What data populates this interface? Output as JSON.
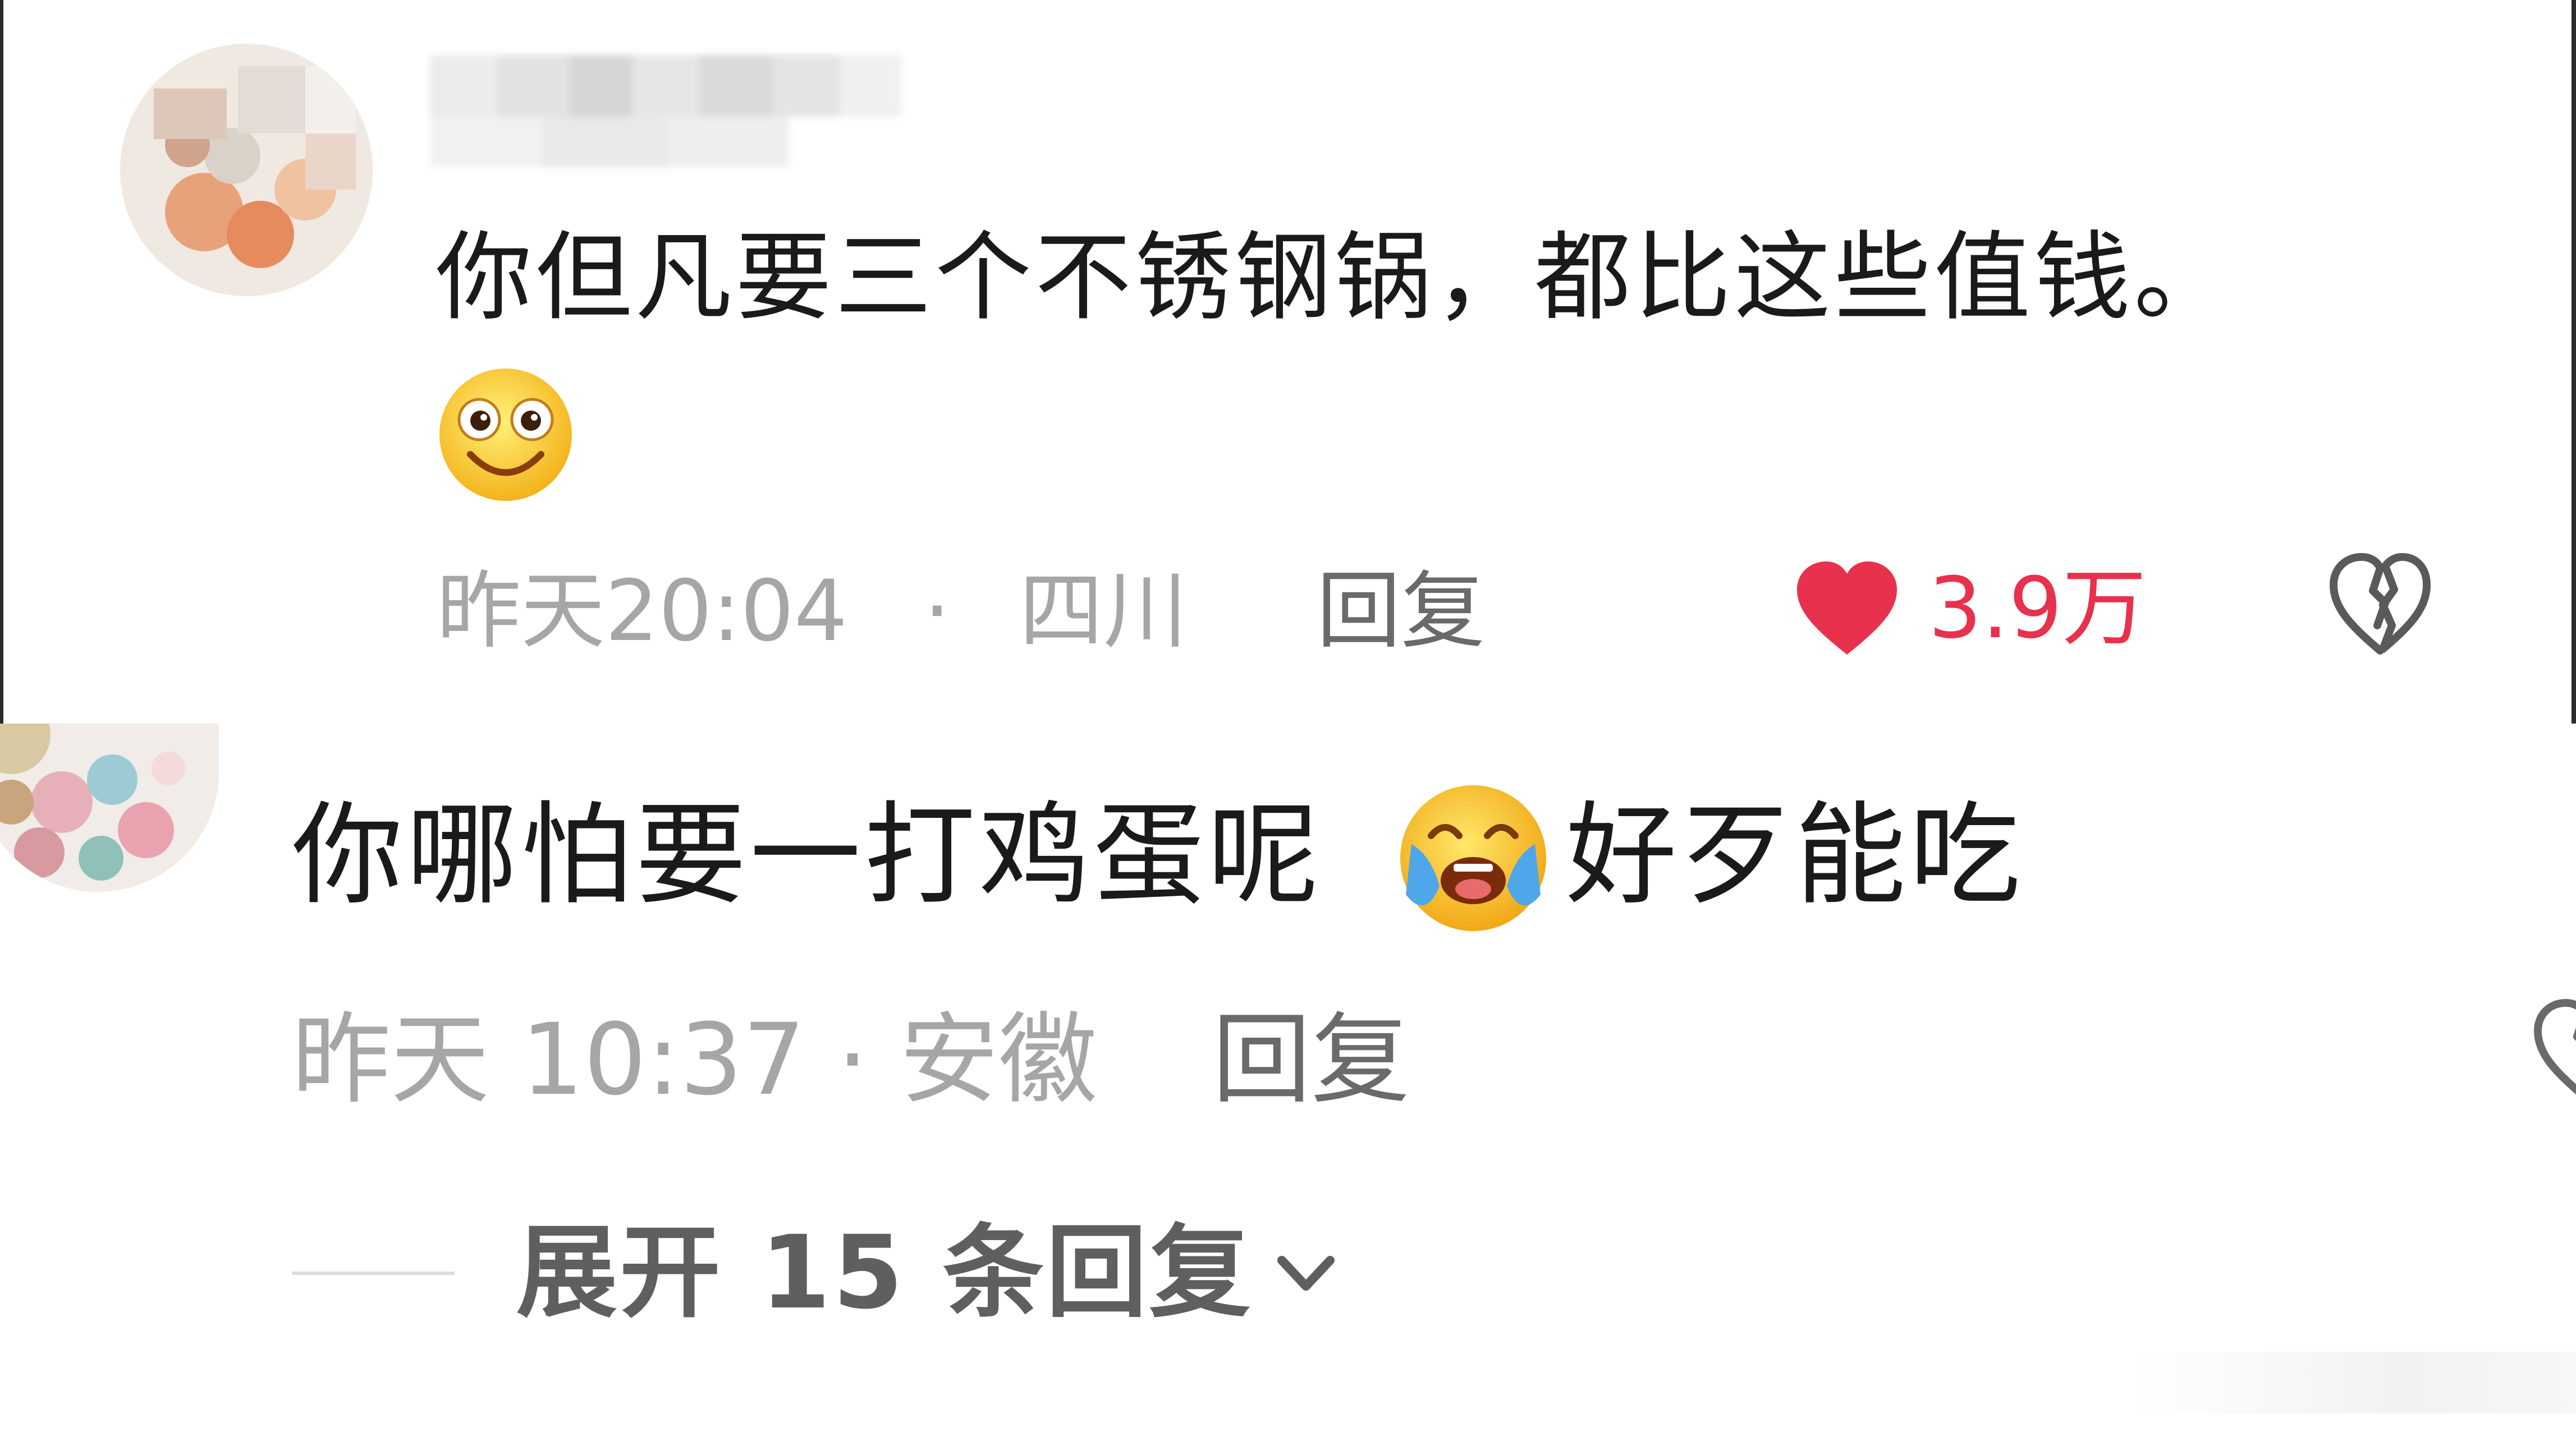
{
  "comments": [
    {
      "username": "",
      "text": "你但凡要三个不锈钢锅，都比这些值钱。",
      "emoji": "smile-emoji",
      "time": "昨天20:04",
      "separator": "·",
      "location": "四川",
      "reply_label": "回复",
      "like_count": "3.9万",
      "liked": true,
      "like_color": "#e8314c"
    },
    {
      "text_before_emoji": "你哪怕要一打鸡蛋呢",
      "emoji": "crying-emoji",
      "text_after_emoji": "好歹能吃",
      "time_location": "昨天 10:37 · 安徽",
      "reply_label": "回复",
      "expand_label": "展开 15 条回复"
    }
  ]
}
